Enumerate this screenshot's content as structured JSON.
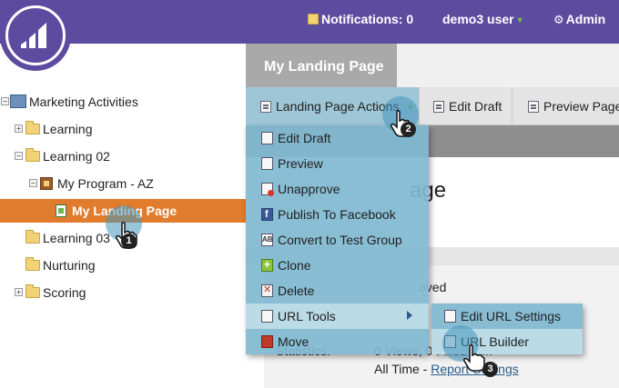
{
  "header": {
    "notifications": "Notifications: 0",
    "user": "demo3 user",
    "admin": "Admin"
  },
  "tree": {
    "root": "Marketing Activities",
    "items": [
      {
        "label": "Learning"
      },
      {
        "label": "Learning 02"
      },
      {
        "label": "My Program - AZ"
      },
      {
        "label": "My Landing Page"
      },
      {
        "label": "Learning 03"
      },
      {
        "label": "Nurturing"
      },
      {
        "label": "Scoring"
      }
    ]
  },
  "main": {
    "tab": "My Landing Page",
    "toolbar": {
      "actions": "Landing Page Actions",
      "edit_draft": "Edit Draft",
      "preview_page": "Preview Page"
    },
    "heading_fragment": "age",
    "status_fragment": "oved",
    "statistics_label": "Statistics:",
    "stats_fragment": "0 Views, 0 Filled    orm",
    "all_time": "All Time - ",
    "report_settings": "Report Settings"
  },
  "menu": {
    "items": [
      {
        "label": "Edit Draft",
        "icon": "edit-icon"
      },
      {
        "label": "Preview",
        "icon": "preview-icon"
      },
      {
        "label": "Unapprove",
        "icon": "unapprove-icon"
      },
      {
        "label": "Publish To Facebook",
        "icon": "facebook-icon"
      },
      {
        "label": "Convert to Test Group",
        "icon": "ab-test-icon"
      },
      {
        "label": "Clone",
        "icon": "clone-icon"
      },
      {
        "label": "Delete",
        "icon": "delete-icon"
      },
      {
        "label": "URL Tools",
        "icon": "url-tools-icon"
      },
      {
        "label": "Move",
        "icon": "move-icon"
      }
    ],
    "submenu": [
      {
        "label": "Edit URL Settings",
        "icon": "edit-url-icon"
      },
      {
        "label": "URL Builder",
        "icon": "url-builder-icon"
      }
    ]
  },
  "steps": [
    "1",
    "2",
    "3"
  ],
  "colors": {
    "header": "#5c4c9f",
    "selected": "#e07c2b",
    "menu": "#80b8d0"
  }
}
